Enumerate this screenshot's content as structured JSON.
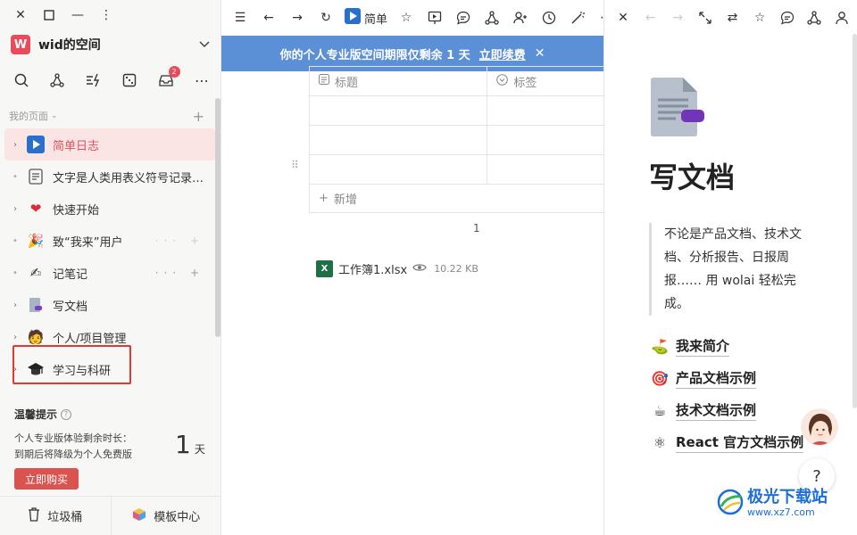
{
  "sidebar": {
    "workspace": {
      "avatar_letter": "W",
      "name": "wid的空间"
    },
    "section_label": "我的页面",
    "items": [
      {
        "label": "简单日志",
        "icon": "play-icon",
        "active": true
      },
      {
        "label": "文字是人类用表义符号记录表达信息以传之久远的方式和工具",
        "icon": "doc-icon"
      },
      {
        "label": "快速开始",
        "icon": "heart-icon"
      },
      {
        "label": "致“我来”用户",
        "icon": "party-icon"
      },
      {
        "label": "记笔记",
        "icon": "pen-icon"
      },
      {
        "label": "写文档",
        "icon": "document-icon"
      },
      {
        "label": "个人/项目管理",
        "icon": "person-icon"
      },
      {
        "label": "学习与科研",
        "icon": "grad-cap-icon"
      }
    ],
    "tools_badge": "2",
    "tip": {
      "title": "温馨提示",
      "line1": "个人专业版体验剩余时长：",
      "line2": "到期后将降级为个人免费版",
      "days": "1",
      "days_unit": "天",
      "buy_label": "立即购买"
    },
    "footer": {
      "trash_label": "垃圾桶",
      "templates_label": "模板中心"
    }
  },
  "main": {
    "tab_title": "简单日",
    "banner": {
      "text": "你的个人专业版空间期限仅剩余 1 天",
      "renew_label": "立即续费"
    },
    "table": {
      "col_title": "标题",
      "col_tag": "标签",
      "add_label": "新增"
    },
    "page_number": "1",
    "file": {
      "name": "工作簿1.xlsx",
      "size": "10.22 KB"
    }
  },
  "panel": {
    "title": "写文档",
    "quote": "不论是产品文档、技术文档、分析报告、日报周报…… 用 wolai 轻松完成。",
    "links": [
      {
        "label": "我来简介",
        "emoji": "⛳"
      },
      {
        "label": "产品文档示例",
        "emoji": "🎯"
      },
      {
        "label": "技术文档示例",
        "emoji": "☕"
      },
      {
        "label": "React 官方文档示例",
        "emoji": "⚛"
      }
    ],
    "help_label": "?",
    "watermark": {
      "line1": "极光下载站",
      "line2": "www.xz7.com"
    }
  }
}
